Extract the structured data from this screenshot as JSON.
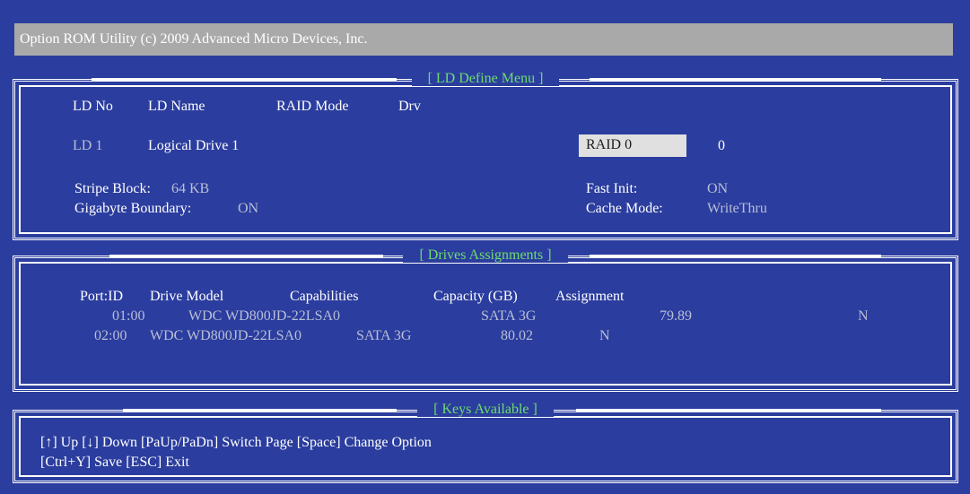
{
  "title": "Option ROM Utility (c) 2009 Advanced Micro Devices, Inc.",
  "ld_define": {
    "heading": "[ LD Define Menu ]",
    "headers": {
      "ld_no": "LD No",
      "ld_name": "LD Name",
      "raid_mode": "RAID Mode",
      "drv": "Drv"
    },
    "row": {
      "ld_no": "LD 1",
      "ld_name": "Logical Drive 1",
      "raid_mode": "RAID 0",
      "drv": "0"
    },
    "stripe_block_label": "Stripe Block:",
    "stripe_block_value": "64  KB",
    "gigabyte_boundary_label": "Gigabyte Boundary:",
    "gigabyte_boundary_value": "ON",
    "fast_init_label": "Fast Init:",
    "fast_init_value": "ON",
    "cache_mode_label": "Cache Mode:",
    "cache_mode_value": "WriteThru"
  },
  "drives": {
    "heading": "[ Drives Assignments ]",
    "headers": {
      "port": "Port:ID",
      "model": "Drive Model",
      "capabilities": "Capabilities",
      "capacity": "Capacity (GB)",
      "assignment": "Assignment"
    },
    "rows": [
      {
        "port": "01:00",
        "model": "WDC WD800JD-22LSA0",
        "capabilities": "SATA 3G",
        "capacity": "79.89",
        "assignment": "N"
      },
      {
        "port": "02:00",
        "model": "WDC WD800JD-22LSA0",
        "capabilities": "SATA 3G",
        "capacity": "80.02",
        "assignment": "N"
      }
    ]
  },
  "keys": {
    "heading": "[ Keys Available ]",
    "line1": "[↑] Up   [↓] Down   [PaUp/PaDn] Switch Page   [Space] Change Option",
    "line2": "[Ctrl+Y] Save  [ESC] Exit"
  }
}
